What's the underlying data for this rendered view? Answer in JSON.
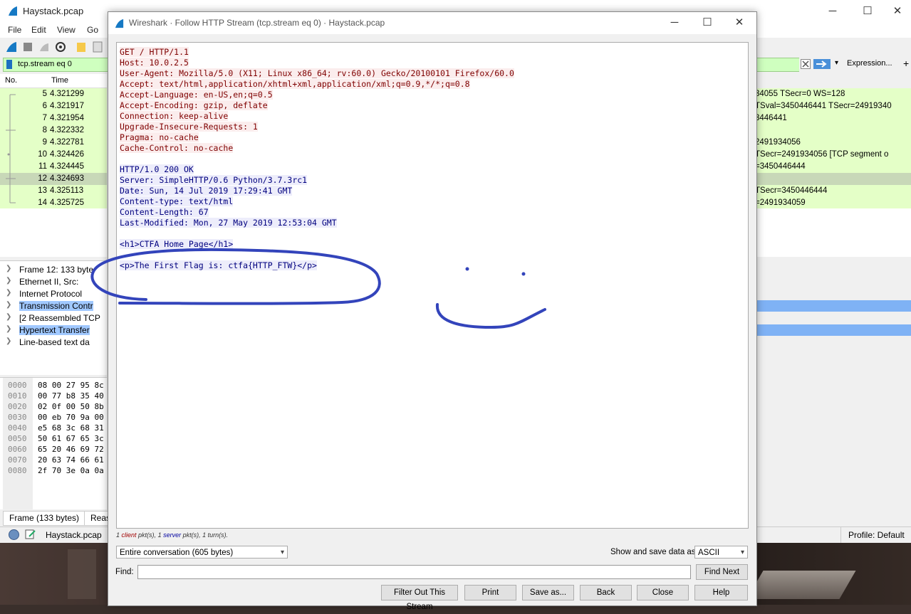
{
  "main_window": {
    "title": "Haystack.pcap",
    "menu": [
      "File",
      "Edit",
      "View",
      "Go"
    ],
    "filter_text": "tcp.stream eq 0",
    "expression_label": "Expression...",
    "packet_list": {
      "headers": [
        "No.",
        "Time"
      ],
      "rows": [
        {
          "no": "5",
          "time": "4.321299",
          "info": "34055 TSecr=0 WS=128",
          "selected": false
        },
        {
          "no": "6",
          "time": "4.321917",
          "info": "TSval=3450446441 TSecr=24919340",
          "selected": false
        },
        {
          "no": "7",
          "time": "4.321954",
          "info": "3446441",
          "selected": false
        },
        {
          "no": "8",
          "time": "4.322332",
          "info": "",
          "selected": false
        },
        {
          "no": "9",
          "time": "4.322781",
          "info": "2491934056",
          "selected": false
        },
        {
          "no": "10",
          "time": "4.324426",
          "info": "TSecr=2491934056 [TCP segment o",
          "selected": false
        },
        {
          "no": "11",
          "time": "4.324445",
          "info": "=3450446444",
          "selected": false
        },
        {
          "no": "12",
          "time": "4.324693",
          "info": "",
          "selected": true
        },
        {
          "no": "13",
          "time": "4.325113",
          "info": "TSecr=3450446444",
          "selected": false
        },
        {
          "no": "14",
          "time": "4.325725",
          "info": "=2491934059",
          "selected": false
        }
      ]
    },
    "details": [
      {
        "label": "Frame 12: 133 byte",
        "highlight": false
      },
      {
        "label": "Ethernet II, Src:",
        "highlight": false
      },
      {
        "label": "Internet Protocol",
        "highlight": false
      },
      {
        "label": "Transmission Contr",
        "highlight": true
      },
      {
        "label": "[2 Reassembled TCP",
        "highlight": false
      },
      {
        "label": "Hypertext Transfer",
        "highlight": true
      },
      {
        "label": "Line-based text da",
        "highlight": false
      }
    ],
    "hex": [
      {
        "off": "0000",
        "bytes": "08 00 27 95 8c"
      },
      {
        "off": "0010",
        "bytes": "00 77 b8 35 40"
      },
      {
        "off": "0020",
        "bytes": "02 0f 00 50 8b"
      },
      {
        "off": "0030",
        "bytes": "00 eb 70 9a 00"
      },
      {
        "off": "0040",
        "bytes": "e5 68 3c 68 31"
      },
      {
        "off": "0050",
        "bytes": "50 61 67 65 3c"
      },
      {
        "off": "0060",
        "bytes": "65 20 46 69 72"
      },
      {
        "off": "0070",
        "bytes": "20 63 74 66 61"
      },
      {
        "off": "0080",
        "bytes": "2f 70 3e 0a 0a"
      }
    ],
    "bottom_tabs": [
      "Frame (133 bytes)",
      "Reas"
    ],
    "status_file": "Haystack.pcap",
    "status_profile": "Profile: Default"
  },
  "dialog": {
    "title": "Wireshark · Follow HTTP Stream (tcp.stream eq 0) · Haystack.pcap",
    "request_lines": [
      "GET / HTTP/1.1",
      "Host: 10.0.2.5",
      "User-Agent: Mozilla/5.0 (X11; Linux x86_64; rv:60.0) Gecko/20100101 Firefox/60.0",
      "Accept: text/html,application/xhtml+xml,application/xml;q=0.9,*/*;q=0.8",
      "Accept-Language: en-US,en;q=0.5",
      "Accept-Encoding: gzip, deflate",
      "Connection: keep-alive",
      "Upgrade-Insecure-Requests: 1",
      "Pragma: no-cache",
      "Cache-Control: no-cache"
    ],
    "response_lines": [
      "HTTP/1.0 200 OK",
      "Server: SimpleHTTP/0.6 Python/3.7.3rc1",
      "Date: Sun, 14 Jul 2019 17:29:41 GMT",
      "Content-type: text/html",
      "Content-Length: 67",
      "Last-Modified: Mon, 27 May 2019 12:53:04 GMT",
      "",
      "<h1>CTFA Home Page</h1>",
      "",
      "<p>The First Flag is: ctfa{HTTP_FTW}</p>"
    ],
    "summary": {
      "client_num": "1",
      "client_word": "client",
      "rest1": " pkt(s), ",
      "server_num": "1",
      "server_word": "server",
      "rest2": " pkt(s), 1 turn(s)."
    },
    "conversation_select": "Entire conversation (605 bytes)",
    "show_save_label": "Show and save data as",
    "format_select": "ASCII",
    "find_label": "Find:",
    "find_value": "",
    "find_next": "Find Next",
    "buttons": {
      "filter_out": "Filter Out This Stream",
      "print": "Print",
      "save_as": "Save as...",
      "back": "Back",
      "close": "Close",
      "help": "Help"
    }
  },
  "annotation_color": "#3344bb"
}
